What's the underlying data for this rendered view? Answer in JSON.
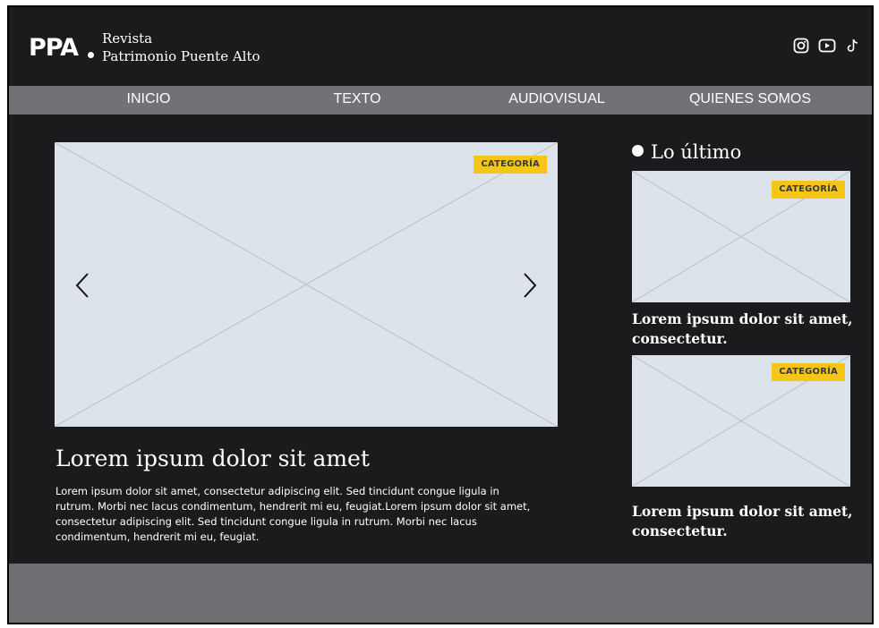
{
  "header": {
    "logo": "PPA",
    "brand_line1": "Revista",
    "brand_line2": "Patrimonio Puente Alto",
    "social": [
      "instagram-icon",
      "youtube-icon",
      "tiktok-icon"
    ]
  },
  "nav": {
    "items": [
      "INICIO",
      "TEXTO",
      "AUDIOVISUAL",
      "QUIENES SOMOS"
    ]
  },
  "featured": {
    "category": "CATEGORÍA",
    "title": "Lorem ipsum dolor sit amet",
    "body": "Lorem ipsum dolor sit amet, consectetur adipiscing elit. Sed tincidunt congue ligula in rutrum. Morbi nec lacus condimentum, hendrerit mi eu, feugiat.Lorem ipsum dolor sit amet, consectetur adipiscing elit. Sed tincidunt congue ligula in rutrum. Morbi nec lacus condimentum, hendrerit mi eu, feugiat.",
    "prev_icon": "chevron-left-icon",
    "next_icon": "chevron-right-icon"
  },
  "latest": {
    "heading": "Lo último",
    "items": [
      {
        "category": "CATEGORÍA",
        "title": "Lorem ipsum dolor sit amet, consectetur."
      },
      {
        "category": "CATEGORÍA",
        "title": "Lorem ipsum dolor sit amet, consectetur."
      }
    ]
  },
  "colors": {
    "background": "#1b1b1d",
    "nav": "#707276",
    "placeholder": "#dde3ea",
    "badge": "#f5c518",
    "footer": "#6e6f73"
  }
}
